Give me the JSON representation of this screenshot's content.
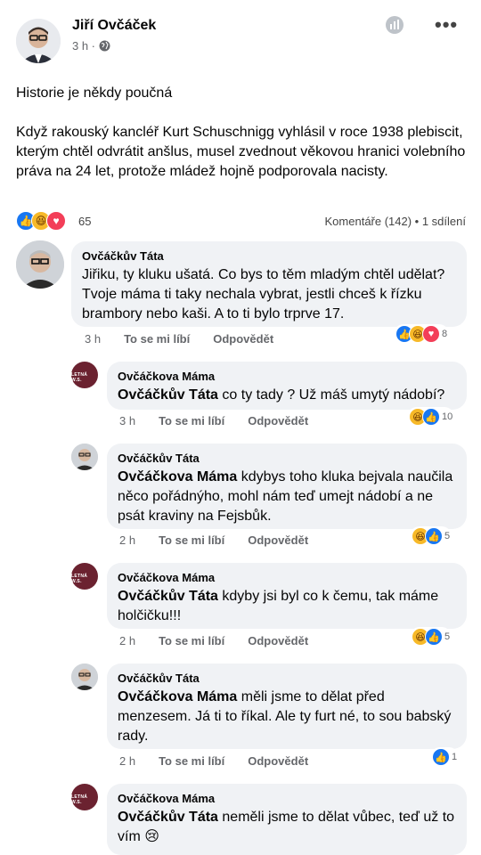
{
  "post": {
    "author": "Jiří Ovčáček",
    "time": "3 h ·",
    "title": "Historie je někdy poučná",
    "body": "Když rakouský kancléř Kurt Schuschnigg vyhlásil v roce 1938 plebiscit, kterým chtěl odvrátit anšlus, musel zvednout věkovou hranici volebního práva na 24 let, protože mládež hojně podporovala nacisty.",
    "reaction_count": "65",
    "comments_shares": "Komentáře (142) • 1 sdílení",
    "icons": [
      "globe-icon",
      "more-icon",
      "like-reaction-icon",
      "haha-reaction-icon",
      "love-reaction-icon"
    ]
  },
  "labels": {
    "like": "To se mi líbí",
    "reply": "Odpovědět"
  },
  "avatar_badge": "LETNÁ W.S.",
  "comments": [
    {
      "name": "Ovčáčkův Táta",
      "mention": "",
      "text": "Jiřiku, ty kluku ušatá. Co bys to těm mladým chtěl udělat? Tvoje máma ti taky nechala vybrat, jestli chceš k řízku brambory nebo kaši. A to ti bylo trprve 17.",
      "time": "3 h",
      "reactions": [
        "like",
        "haha",
        "love"
      ],
      "count": "8"
    },
    {
      "name": "Ovčáčkova Máma",
      "mention": "Ovčáčkův Táta",
      "text": " co ty tady ? Už máš umytý nádobí?",
      "time": "3 h",
      "reactions": [
        "haha",
        "like"
      ],
      "count": "10"
    },
    {
      "name": "Ovčáčkův Táta",
      "mention": "Ovčáčkova Máma",
      "text": " kdybys toho kluka bejvala naučila něco pořádnýho, mohl nám teď umejt nádobí a ne psát kraviny na Fejsbůk.",
      "time": "2 h",
      "reactions": [
        "haha",
        "like"
      ],
      "count": "5"
    },
    {
      "name": "Ovčáčkova Máma",
      "mention": "Ovčáčkův Táta",
      "text": " kdyby jsi byl co k čemu, tak máme holčičku!!!",
      "time": "2 h",
      "reactions": [
        "haha",
        "like"
      ],
      "count": "5"
    },
    {
      "name": "Ovčáčkův Táta",
      "mention": "Ovčáčkova Máma",
      "text": " měli jsme to dělat před menzesem. Já ti to říkal. Ale ty furt né, to sou babský rady.",
      "time": "2 h",
      "reactions": [
        "like"
      ],
      "count": "1"
    },
    {
      "name": "Ovčáčkova Máma",
      "mention": "Ovčáčkův Táta",
      "text": " neměli jsme to dělat vůbec, teď už to vím 😢",
      "time": "",
      "reactions": [],
      "count": ""
    }
  ]
}
